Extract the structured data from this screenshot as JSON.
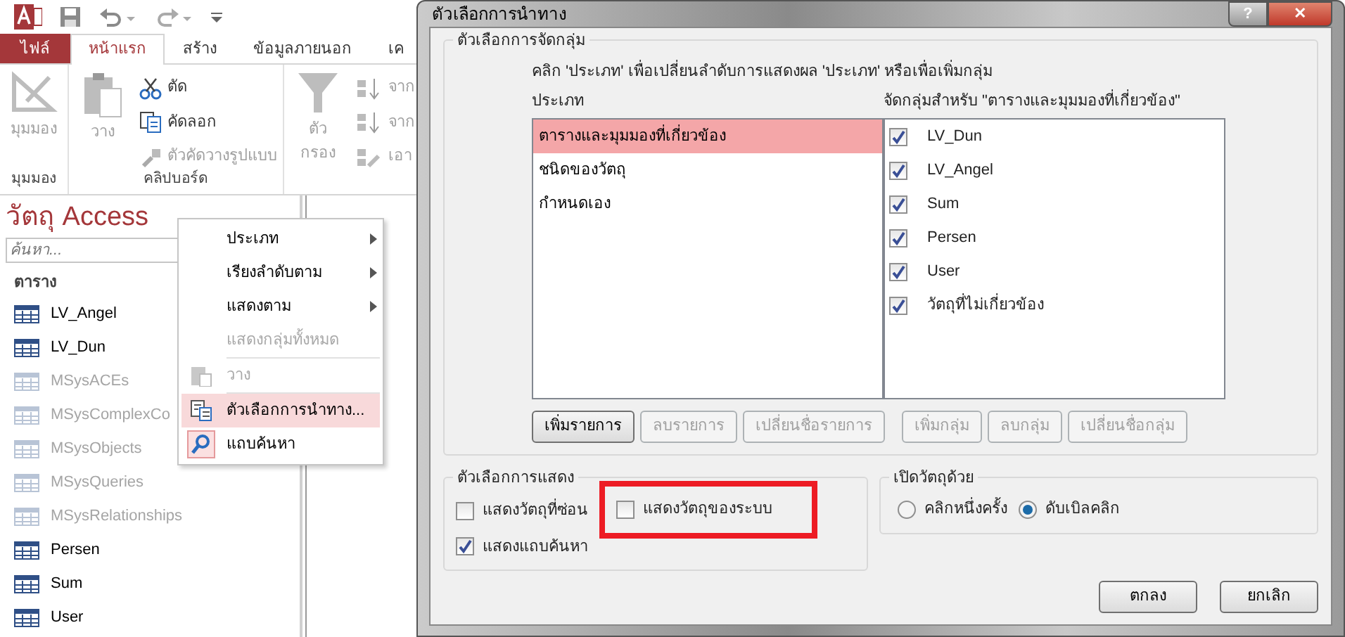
{
  "ribbon_tabs": [
    {
      "label": "ไฟล์",
      "kind": "file",
      "selected": false
    },
    {
      "label": "หน้าแรก",
      "kind": "tab",
      "selected": true
    },
    {
      "label": "สร้าง",
      "kind": "tab",
      "selected": false
    },
    {
      "label": "ข้อมูลภายนอก",
      "kind": "tab",
      "selected": false
    },
    {
      "label": "เค",
      "kind": "tab",
      "selected": false
    }
  ],
  "ribbon_groups": [
    {
      "label": "มุมมอง",
      "commands": [
        {
          "label": "มุมมอง",
          "kind": "view",
          "disabled": true
        }
      ]
    },
    {
      "label": "คลิปบอร์ด",
      "commands": [
        {
          "label": "วาง",
          "kind": "paste",
          "disabled": true
        },
        {
          "label": "ตัด",
          "kind": "cut",
          "disabled": false
        },
        {
          "label": "คัดลอก",
          "kind": "copy",
          "disabled": false
        },
        {
          "label": "ตัวคัดวางรูปแบบ",
          "kind": "painter",
          "disabled": true
        }
      ]
    },
    {
      "commands": [
        {
          "label": "ตัว กรอง",
          "kind": "filter",
          "disabled": true
        },
        {
          "label": "จาก",
          "kind": "sort-asc",
          "disabled": true
        },
        {
          "label": "จาก",
          "kind": "sort-desc",
          "disabled": true
        },
        {
          "label": "เอา",
          "kind": "clear-sort",
          "disabled": true
        }
      ]
    }
  ],
  "nav_pane": {
    "title": "วัตถุ Access",
    "search": {
      "placeholder": "ค้นหา..."
    },
    "group": "ตาราง",
    "items": [
      {
        "label": "LV_Angel",
        "dimmed": false
      },
      {
        "label": "LV_Dun",
        "dimmed": false
      },
      {
        "label": "MSysACEs",
        "dimmed": true
      },
      {
        "label": "MSysComplexCo",
        "dimmed": true
      },
      {
        "label": "MSysObjects",
        "dimmed": true
      },
      {
        "label": "MSysQueries",
        "dimmed": true
      },
      {
        "label": "MSysRelationships",
        "dimmed": true
      },
      {
        "label": "Persen",
        "dimmed": false
      },
      {
        "label": "Sum",
        "dimmed": false
      },
      {
        "label": "User",
        "dimmed": false
      }
    ]
  },
  "context_menu": {
    "items": [
      {
        "label": "ประเภท",
        "kind": "submenu",
        "disabled": false,
        "selected": false
      },
      {
        "label": "เรียงลำดับตาม",
        "kind": "submenu",
        "disabled": false,
        "selected": false
      },
      {
        "label": "แสดงตาม",
        "kind": "submenu",
        "disabled": false,
        "selected": false
      },
      {
        "label": "แสดงกลุ่มทั้งหมด",
        "kind": "plain",
        "disabled": true,
        "selected": false
      },
      {
        "label": "วาง",
        "kind": "paste",
        "disabled": true,
        "selected": false
      },
      {
        "label": "ตัวเลือกการนำทาง...",
        "kind": "options",
        "disabled": false,
        "selected": true
      },
      {
        "label": "แถบค้นหา",
        "kind": "search",
        "disabled": false,
        "selected": false
      }
    ]
  },
  "dialog": {
    "title": "ตัวเลือกการนำทาง",
    "help": "?",
    "close": "✕",
    "grouping": {
      "legend": "ตัวเลือกการจัดกลุ่ม",
      "instruction": "คลิก 'ประเภท' เพื่อเปลี่ยนลำดับการแสดงผล 'ประเภท' หรือเพื่อเพิ่มกลุ่ม",
      "categories_header": "ประเภท",
      "groups_header": "จัดกลุ่มสำหรับ \"ตารางและมุมมองที่เกี่ยวข้อง\"",
      "categories": [
        {
          "label": "ตารางและมุมมองที่เกี่ยวข้อง",
          "selected": true
        },
        {
          "label": "ชนิดของวัตถุ",
          "selected": false
        },
        {
          "label": "กำหนดเอง",
          "selected": false
        }
      ],
      "groups": [
        {
          "label": "LV_Dun",
          "checked": true
        },
        {
          "label": "LV_Angel",
          "checked": true
        },
        {
          "label": "Sum",
          "checked": true
        },
        {
          "label": "Persen",
          "checked": true
        },
        {
          "label": "User",
          "checked": true
        },
        {
          "label": "วัตถุที่ไม่เกี่ยวข้อง",
          "checked": true
        }
      ],
      "buttons": [
        {
          "label": "เพิ่มรายการ",
          "disabled": false
        },
        {
          "label": "ลบรายการ",
          "disabled": true
        },
        {
          "label": "เปลี่ยนชื่อรายการ",
          "disabled": true
        },
        {
          "label": "เพิ่มกลุ่ม",
          "disabled": true
        },
        {
          "label": "ลบกลุ่ม",
          "disabled": true
        },
        {
          "label": "เปลี่ยนชื่อกลุ่ม",
          "disabled": true
        }
      ]
    },
    "display_options": {
      "legend": "ตัวเลือกการแสดง",
      "options": [
        {
          "label": "แสดงวัตถุที่ซ่อน",
          "checked": false,
          "annotated": false
        },
        {
          "label": "แสดงวัตถุของระบบ",
          "checked": false,
          "annotated": true
        },
        {
          "label": "แสดงแถบค้นหา",
          "checked": true,
          "annotated": false
        }
      ]
    },
    "open_with": {
      "legend": "เปิดวัตถุด้วย",
      "options": [
        {
          "label": "คลิกหนึ่งครั้ง",
          "selected": false
        },
        {
          "label": "ดับเบิลคลิก",
          "selected": true
        }
      ]
    },
    "buttons": [
      {
        "label": "ตกลง"
      },
      {
        "label": "ยกเลิก"
      }
    ]
  }
}
